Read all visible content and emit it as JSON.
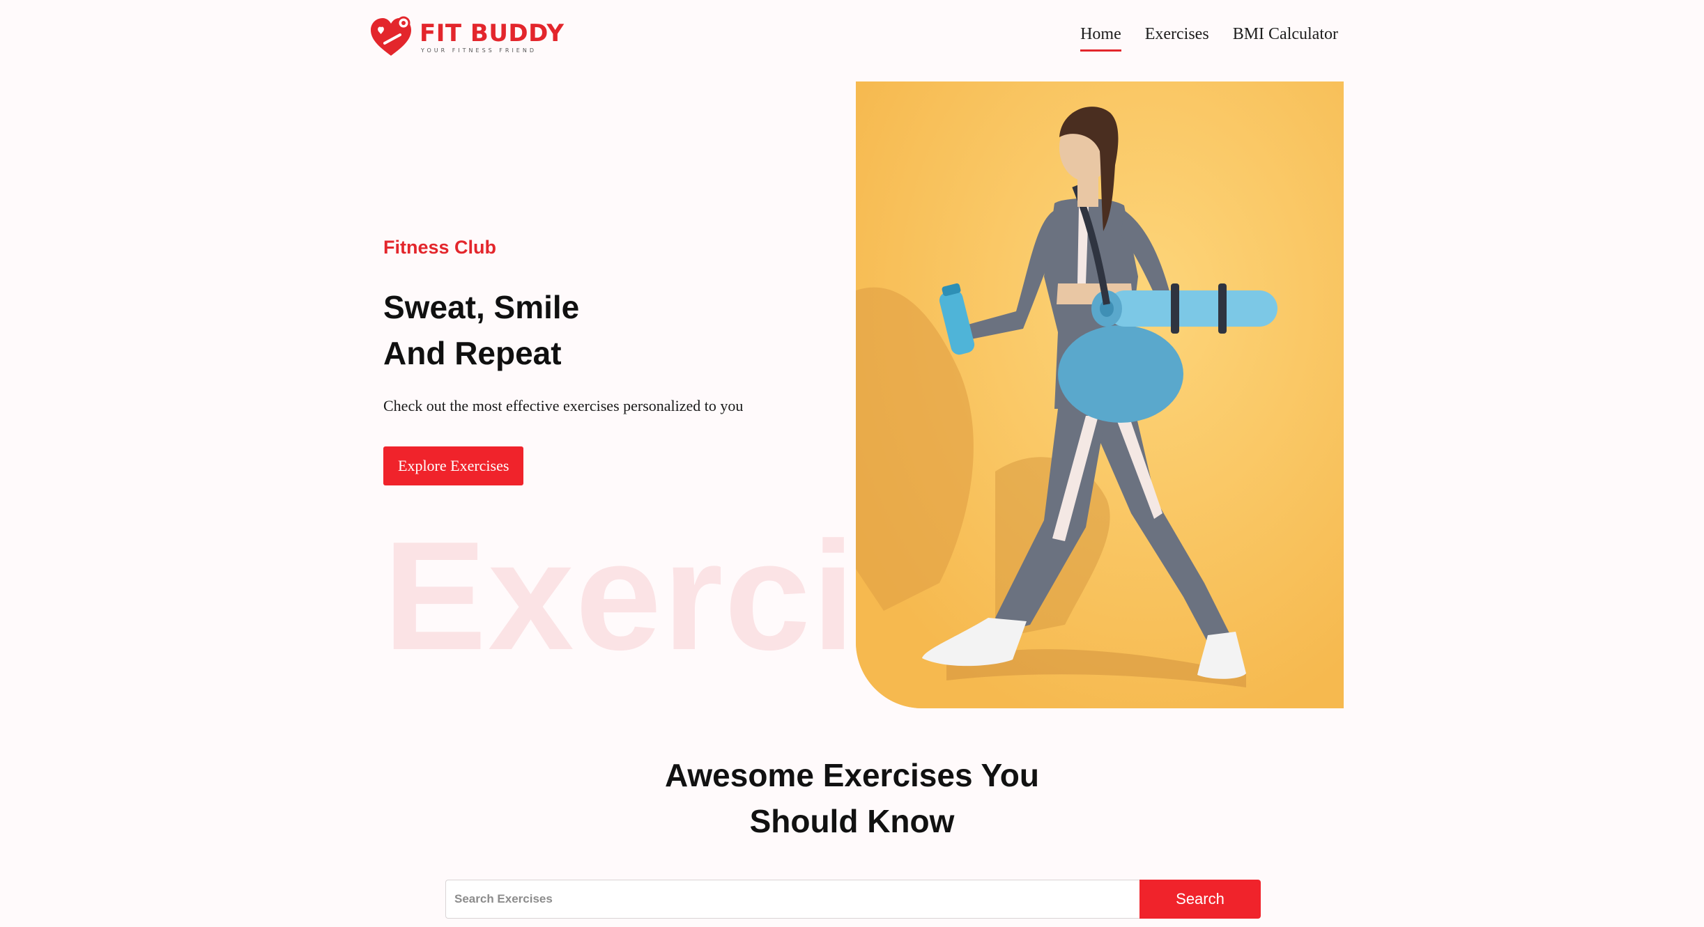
{
  "brand": {
    "name": "FIT BUDDY",
    "tagline": "YOUR FITNESS FRIEND",
    "color": "#e3262c"
  },
  "nav": {
    "items": [
      {
        "label": "Home",
        "active": true
      },
      {
        "label": "Exercises",
        "active": false
      },
      {
        "label": "BMI Calculator",
        "active": false
      }
    ]
  },
  "hero": {
    "kicker": "Fitness Club",
    "heading_line1": "Sweat, Smile",
    "heading_line2": "And Repeat",
    "subtext": "Check out the most effective exercises personalized to you",
    "cta_label": "Explore Exercises",
    "watermark": "Exercise",
    "image_icon": "woman-walking-with-yoga-mat-photo"
  },
  "exercises_section": {
    "heading_line1": "Awesome Exercises You",
    "heading_line2": "Should Know",
    "search": {
      "placeholder": "Search Exercises",
      "value": "",
      "button_label": "Search"
    }
  },
  "colors": {
    "accent": "#f0232b",
    "background": "#fffafb",
    "hero_image_bg": "#fcc865"
  }
}
